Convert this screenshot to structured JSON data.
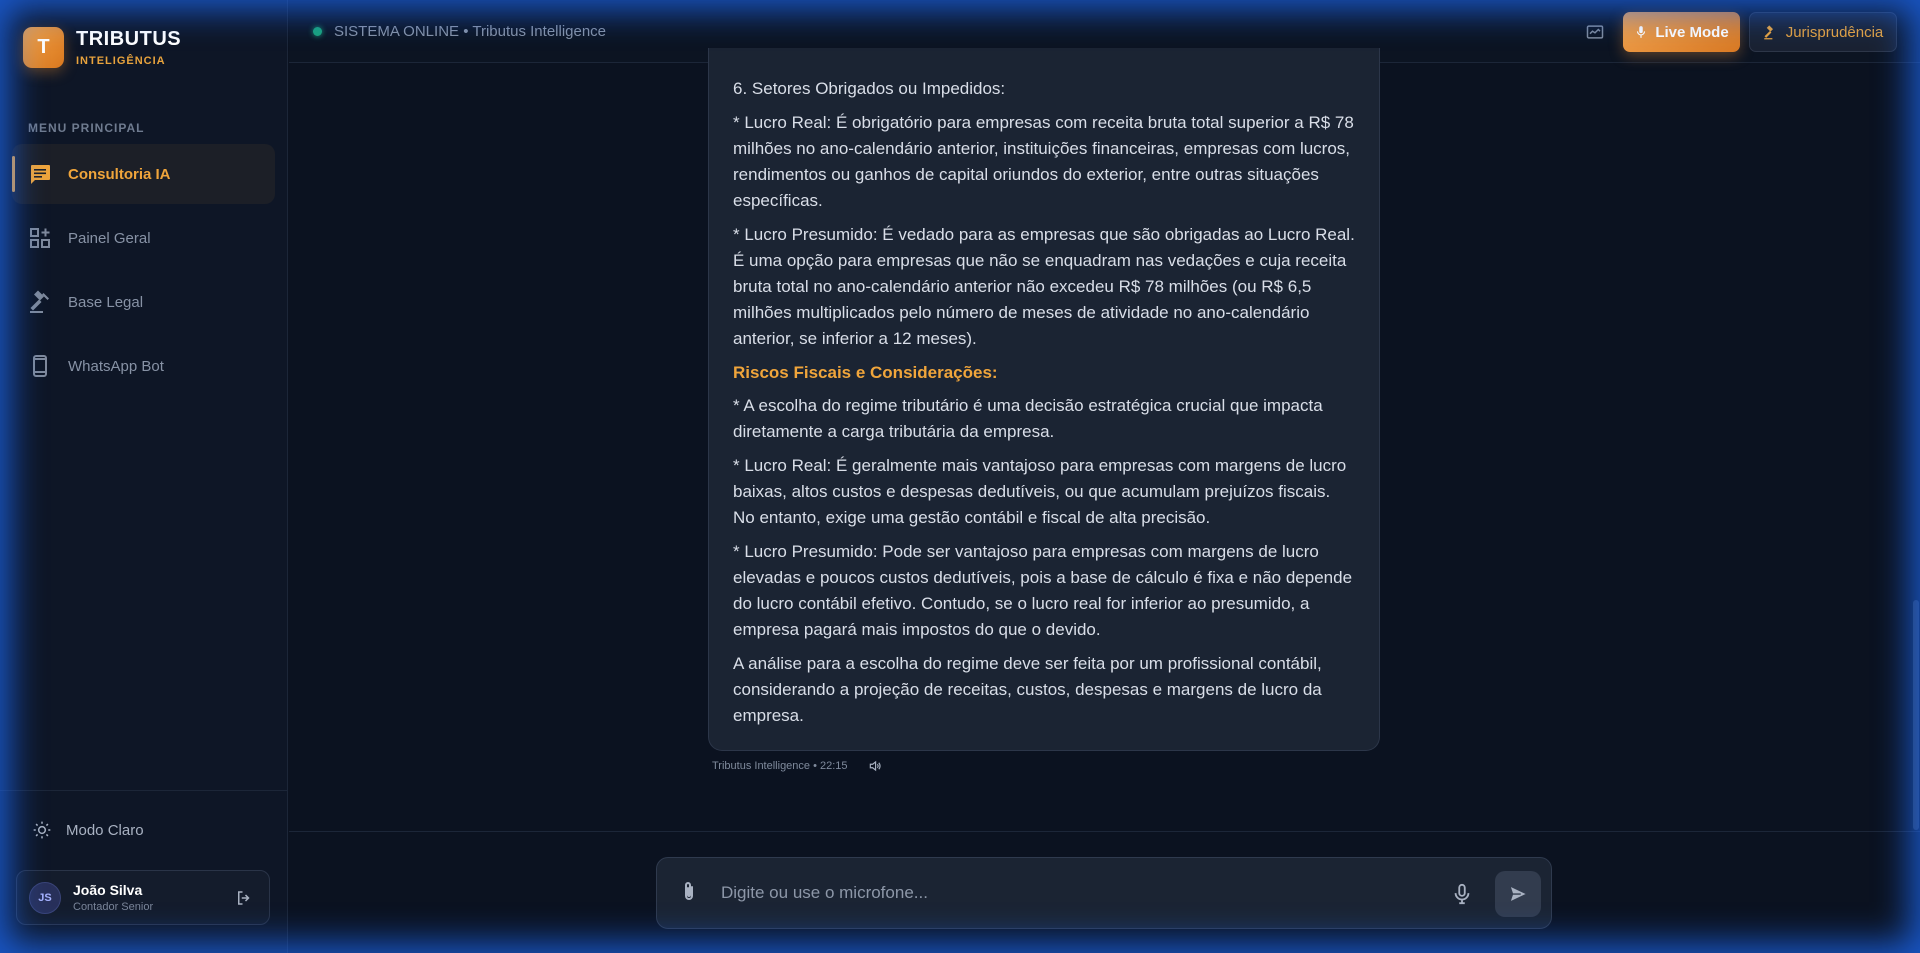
{
  "brand": {
    "logo_letter": "T",
    "name": "TRIBUTUS",
    "subtitle": "INTELIGÊNCIA",
    "accent_color": "#f0a53b"
  },
  "sidebar": {
    "section_title": "MENU PRINCIPAL",
    "items": [
      {
        "label": "Consultoria IA",
        "icon": "chat-icon",
        "active": true
      },
      {
        "label": "Painel Geral",
        "icon": "dashboard-icon",
        "active": false
      },
      {
        "label": "Base Legal",
        "icon": "gavel-icon",
        "active": false
      },
      {
        "label": "WhatsApp Bot",
        "icon": "smartphone-icon",
        "active": false
      }
    ],
    "mode_toggle": "Modo Claro",
    "user": {
      "initials": "JS",
      "name": "João Silva",
      "role": "Contador Senior"
    }
  },
  "header": {
    "status": "SISTEMA ONLINE • Tributus Intelligence",
    "status_color": "#1aa37a",
    "live_mode_label": "Live Mode",
    "jurisprudence_label": "Jurisprudência"
  },
  "message": {
    "paragraphs": [
      "6. Setores Obrigados ou Impedidos:",
      "* Lucro Real: É obrigatório para empresas com receita bruta total superior a R$ 78 milhões no ano-calendário anterior, instituições financeiras, empresas com lucros, rendimentos ou ganhos de capital oriundos do exterior, entre outras situações específicas.",
      "* Lucro Presumido: É vedado para as empresas que são obrigadas ao Lucro Real. É uma opção para empresas que não se enquadram nas vedações e cuja receita bruta total no ano-calendário anterior não excedeu R$ 78 milhões (ou R$ 6,5 milhões multiplicados pelo número de meses de atividade no ano-calendário anterior, se inferior a 12 meses).",
      "Riscos Fiscais e Considerações:",
      "* A escolha do regime tributário é uma decisão estratégica crucial que impacta diretamente a carga tributária da empresa.",
      "* Lucro Real: É geralmente mais vantajoso para empresas com margens de lucro baixas, altos custos e despesas dedutíveis, ou que acumulam prejuízos fiscais. No entanto, exige uma gestão contábil e fiscal de alta precisão.",
      "* Lucro Presumido: Pode ser vantajoso para empresas com margens de lucro elevadas e poucos custos dedutíveis, pois a base de cálculo é fixa e não depende do lucro contábil efetivo. Contudo, se o lucro real for inferior ao presumido, a empresa pagará mais impostos do que o devido.",
      "A análise para a escolha do regime deve ser feita por um profissional contábil, considerando a projeção de receitas, custos, despesas e margens de lucro da empresa."
    ],
    "meta": "Tributus Intelligence • 22:15"
  },
  "composer": {
    "placeholder": "Digite ou use o microfone..."
  }
}
